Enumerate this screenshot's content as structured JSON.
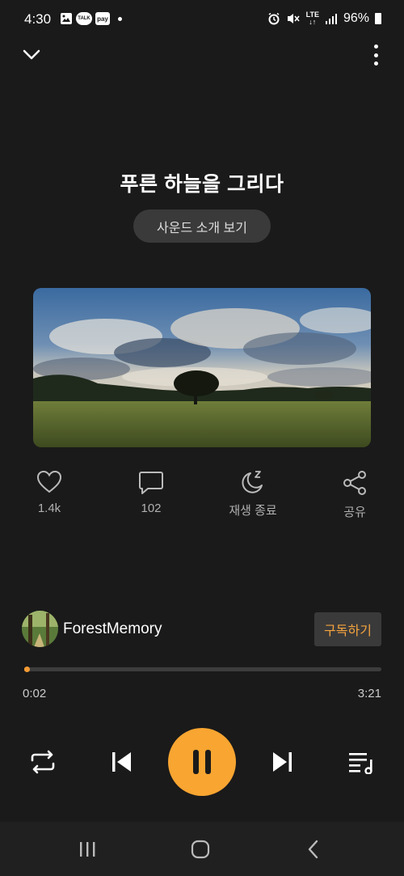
{
  "status_bar": {
    "time": "4:30",
    "left_icons": [
      "gallery-icon",
      "talk-icon",
      "pay-icon",
      "dot-icon"
    ],
    "talk_label": "TALK",
    "pay_label": "pay",
    "network": "LTE",
    "battery": "96%",
    "right_icons": [
      "alarm-icon",
      "mute-icon",
      "lte-icon",
      "signal-icon",
      "battery-icon"
    ]
  },
  "top_bar": {
    "left_icon": "chevron-down-icon",
    "right_icon": "more-vert-icon"
  },
  "track": {
    "title": "푸른 하늘을 그리다",
    "intro_button": "사운드 소개 보기"
  },
  "actions": [
    {
      "icon": "heart-icon",
      "label": "1.4k"
    },
    {
      "icon": "comment-icon",
      "label": "102"
    },
    {
      "icon": "sleep-timer-icon",
      "label": "재생 종료"
    },
    {
      "icon": "share-icon",
      "label": "공유"
    }
  ],
  "channel": {
    "name": "ForestMemory",
    "subscribe": "구독하기"
  },
  "progress": {
    "current": "0:02",
    "total": "3:21",
    "fraction": 0.0099
  },
  "controls": [
    "repeat-icon",
    "previous-icon",
    "pause-icon",
    "next-icon",
    "playlist-icon"
  ],
  "nav": [
    "recents-icon",
    "home-icon",
    "back-icon"
  ],
  "colors": {
    "accent": "#f8a531",
    "background": "#1a1a1a",
    "button_bg": "#3a3a3a"
  }
}
